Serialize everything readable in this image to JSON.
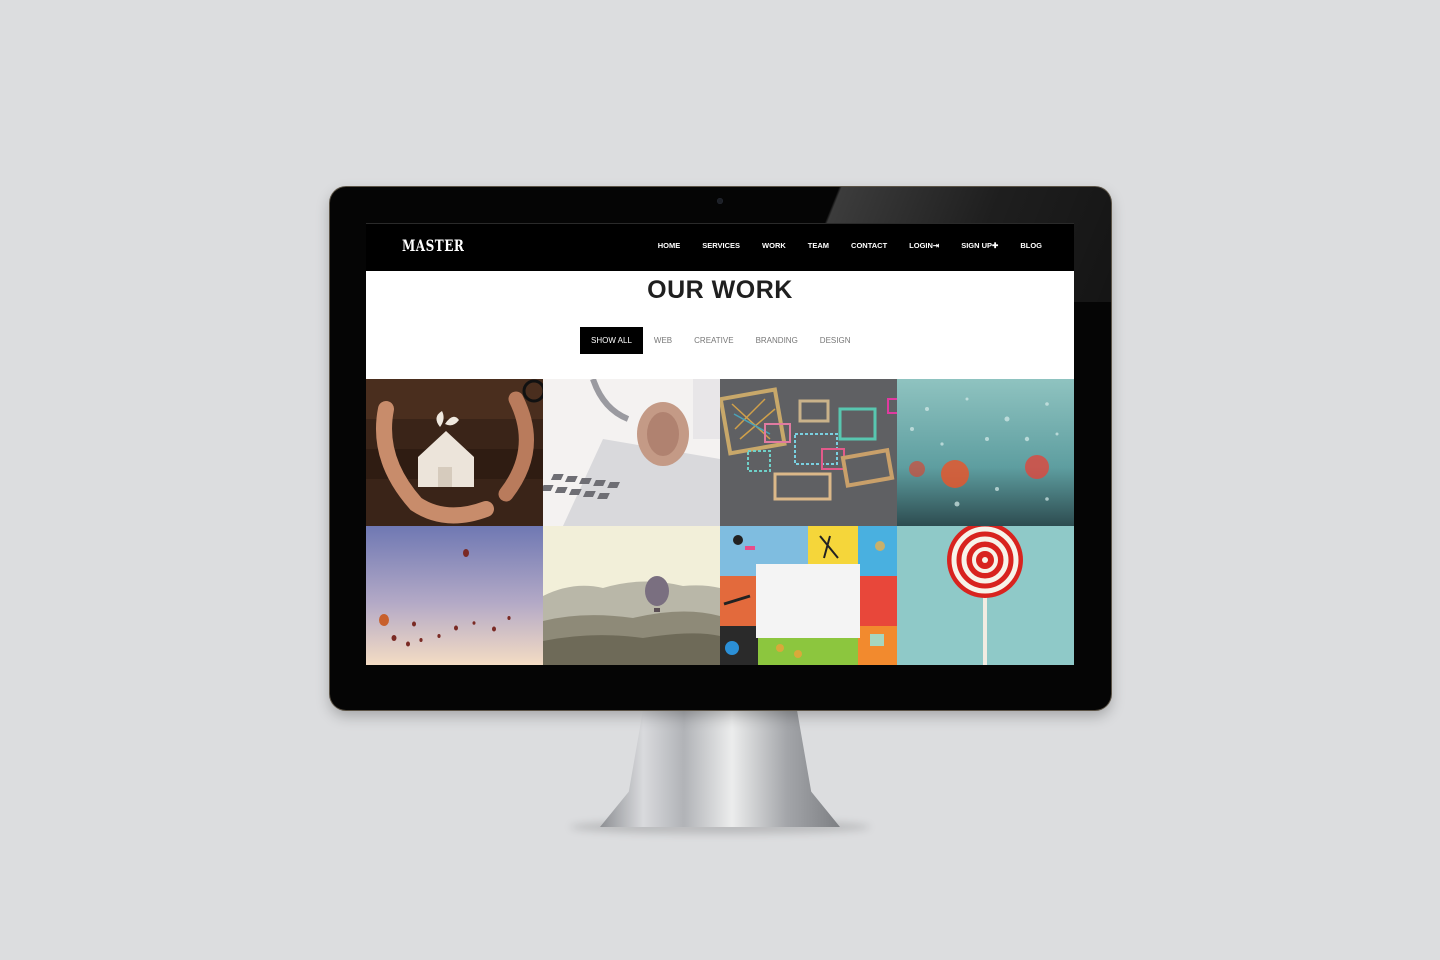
{
  "site": {
    "logo": "MASTER"
  },
  "nav": {
    "items": [
      "HOME",
      "SERVICES",
      "WORK",
      "TEAM",
      "CONTACT",
      "LOGIN⇥",
      "SIGN UP✚",
      "BLOG"
    ]
  },
  "section": {
    "title": "OUR WORK"
  },
  "filters": {
    "items": [
      "SHOW ALL",
      "WEB",
      "CREATIVE",
      "BRANDING",
      "DESIGN"
    ],
    "active": "SHOW ALL"
  },
  "portfolio": {
    "items": [
      {
        "subject": "hands-around-house"
      },
      {
        "subject": "laptop-and-headphones"
      },
      {
        "subject": "colored-frames-on-concrete"
      },
      {
        "subject": "rain-on-window"
      },
      {
        "subject": "hot-air-balloons-sky"
      },
      {
        "subject": "balloon-over-landscape"
      },
      {
        "subject": "stationery-flat-lay"
      },
      {
        "subject": "lollipop"
      }
    ]
  },
  "colors": {
    "navbar": "#000000",
    "active_filter": "#000000",
    "page_background": "#dcdddf"
  }
}
